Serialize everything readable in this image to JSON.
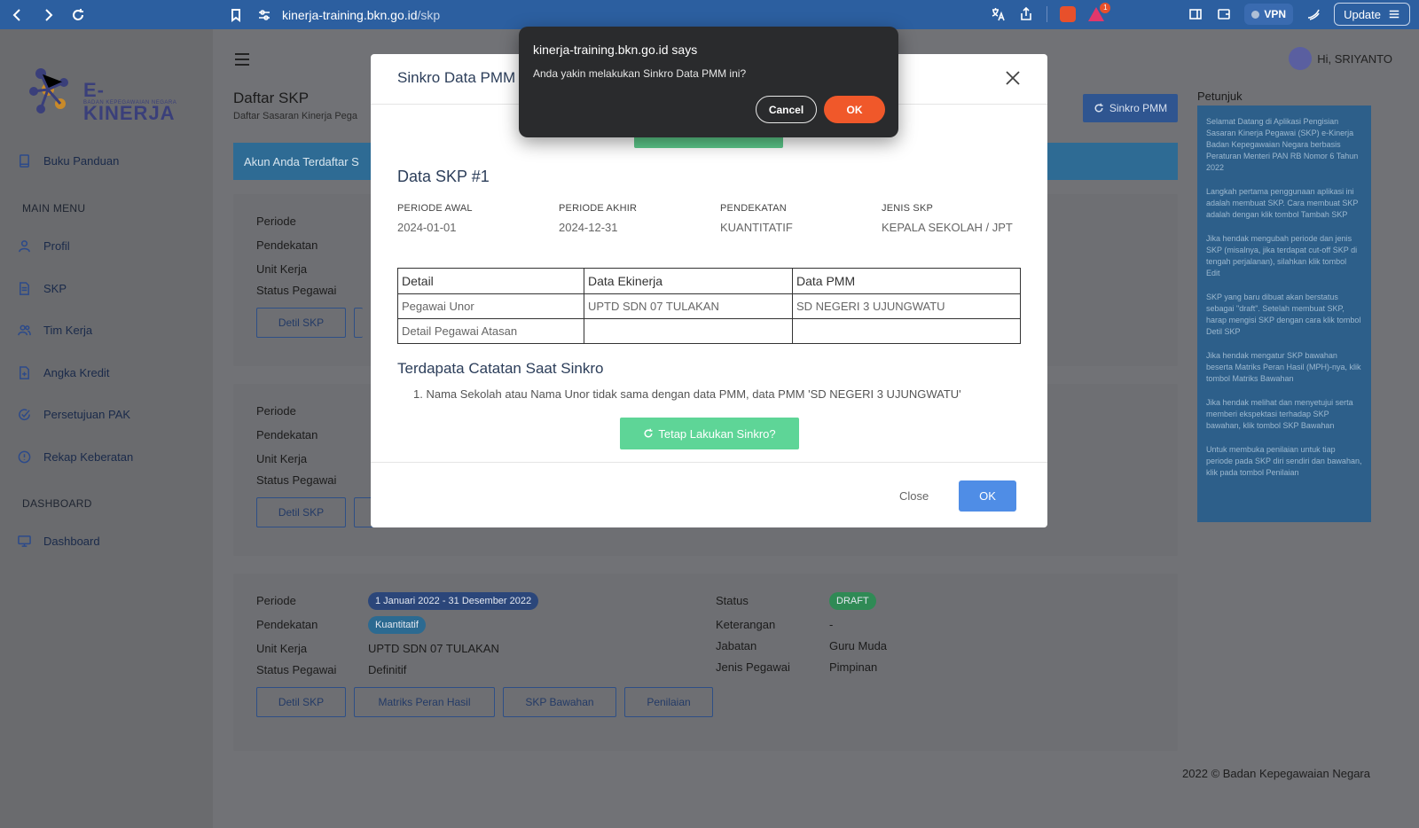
{
  "browser": {
    "url_host": "kinerja-training.bkn.go.id",
    "url_path": "/skp",
    "vpn_label": "VPN",
    "update_label": "Update",
    "notification_count": "1"
  },
  "logo": {
    "title": "E-KINERJA",
    "subtitle": "BADAN KEPEGAWAIAN NEGARA"
  },
  "sidebar": {
    "buku_panduan": "Buku Panduan",
    "main_menu_heading": "MAIN MENU",
    "items": [
      "Profil",
      "SKP",
      "Tim Kerja",
      "Angka Kredit",
      "Persetujuan PAK",
      "Rekap Keberatan"
    ],
    "dashboard_heading": "DASHBOARD",
    "dashboard": "Dashboard"
  },
  "header": {
    "user_greeting": "Hi, SRIYANTO"
  },
  "page": {
    "title": "Daftar SKP",
    "subtitle": "Daftar Sasaran Kinerja Pega",
    "sinkro_button": "Sinkro PMM",
    "info_bar": "Akun Anda Terdaftar S"
  },
  "cards": {
    "labels": {
      "periode": "Periode",
      "pendekatan": "Pendekatan",
      "unit_kerja": "Unit Kerja",
      "status_pegawai": "Status Pegawai",
      "status": "Status",
      "keterangan": "Keterangan",
      "jabatan": "Jabatan",
      "jenis_pegawai": "Jenis Pegawai"
    },
    "third": {
      "periode": "1 Januari 2022 - 31 Desember 2022",
      "pendekatan": "Kuantitatif",
      "unit_kerja": "UPTD SDN 07 TULAKAN",
      "status_pegawai": "Definitif",
      "status": "DRAFT",
      "keterangan": "-",
      "jabatan": "Guru Muda",
      "jenis_pegawai": "Pimpinan"
    },
    "buttons": {
      "detil": "Detil SKP",
      "matriks": "Matriks Peran Hasil",
      "bawahan": "SKP Bawahan",
      "penilaian": "Penilaian"
    }
  },
  "petunjuk": {
    "heading": "Petunjuk",
    "paragraphs": [
      "Selamat Datang di Aplikasi Pengisian Sasaran Kinerja Pegawai (SKP) e-Kinerja Badan Kepegawaian Negara berbasis Peraturan Menteri PAN RB Nomor 6 Tahun 2022",
      "Langkah pertama penggunaan aplikasi ini adalah membuat SKP. Cara membuat SKP adalah dengan klik tombol Tambah SKP",
      "Jika hendak mengubah periode dan jenis SKP (misalnya, jika terdapat cut-off SKP di tengah perjalanan), silahkan klik tombol Edit",
      "SKP yang baru dibuat akan berstatus sebagai \"draft\". Setelah membuat SKP, harap mengisi SKP dengan cara klik tombol Detil SKP",
      "Jika hendak mengatur SKP bawahan beserta Matriks Peran Hasil (MPH)-nya, klik tombol Matriks Bawahan",
      "Jika hendak melihat dan menyetujui serta memberi ekspektasi terhadap SKP bawahan, klik tombol SKP Bawahan",
      "Untuk membuka penilaian untuk tiap periode pada SKP diri sendiri dan bawahan, klik pada tombol Penilaian"
    ]
  },
  "footer": "2022 © Badan Kepegawaian Negara",
  "modal": {
    "title": "Sinkro Data PMM",
    "data_title": "Data SKP #1",
    "meta": [
      {
        "key": "PERIODE AWAL",
        "value": "2024-01-01"
      },
      {
        "key": "PERIODE AKHIR",
        "value": "2024-12-31"
      },
      {
        "key": "PENDEKATAN",
        "value": "KUANTITATIF"
      },
      {
        "key": "JENIS SKP",
        "value": "KEPALA SEKOLAH / JPT"
      }
    ],
    "table": {
      "headers": [
        "Detail",
        "Data Ekinerja",
        "Data PMM"
      ],
      "rows": [
        [
          "Pegawai Unor",
          "UPTD SDN 07 TULAKAN",
          "SD NEGERI 3 UJUNGWATU"
        ],
        [
          "Detail Pegawai Atasan",
          "",
          ""
        ]
      ]
    },
    "note_title": "Terdapata Catatan Saat Sinkro",
    "notes": [
      "1. Nama Sekolah atau Nama Unor tidak sama dengan data PMM, data PMM 'SD NEGERI 3 UJUNGWATU'"
    ],
    "tetap_button": "Tetap Lakukan Sinkro?",
    "close_label": "Close",
    "ok_label": "OK"
  },
  "dialog": {
    "title": "kinerja-training.bkn.go.id says",
    "message": "Anda yakin melakukan Sinkro Data PMM ini?",
    "cancel": "Cancel",
    "ok": "OK"
  }
}
